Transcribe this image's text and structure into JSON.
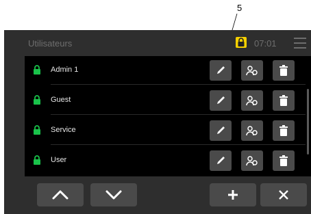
{
  "callout": {
    "number": "5"
  },
  "header": {
    "title": "Utilisateurs",
    "time": "07:01",
    "lock_color": "#f5d000"
  },
  "users": [
    {
      "name": "Admin 1"
    },
    {
      "name": "Guest"
    },
    {
      "name": "Service"
    },
    {
      "name": "User"
    }
  ],
  "colors": {
    "lock_green": "#19c24a",
    "button_bg": "#4a4a4a",
    "icon_white": "#ffffff"
  },
  "icons": {
    "row_actions": [
      "pencil-icon",
      "user-permissions-icon",
      "trash-icon"
    ],
    "footer": [
      "chevron-up-icon",
      "chevron-down-icon",
      "plus-icon",
      "close-icon"
    ]
  }
}
